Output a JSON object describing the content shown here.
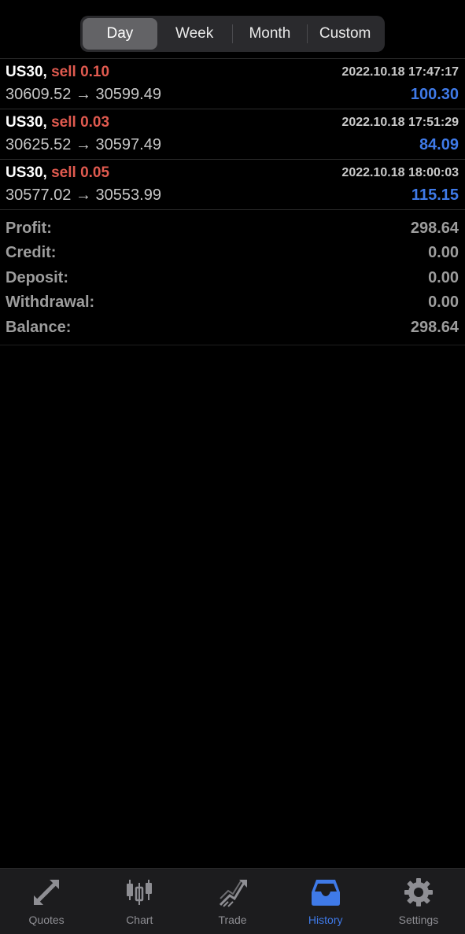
{
  "segments": {
    "day": "Day",
    "week": "Week",
    "month": "Month",
    "custom": "Custom",
    "selected": "Day"
  },
  "trades": [
    {
      "symbol": "US30,",
      "side_lot": "sell 0.10",
      "time": "2022.10.18 17:47:17",
      "open_price": "30609.52",
      "close_price": "30599.49",
      "arrow": "→",
      "profit": "100.30"
    },
    {
      "symbol": "US30,",
      "side_lot": "sell 0.03",
      "time": "2022.10.18 17:51:29",
      "open_price": "30625.52",
      "close_price": "30597.49",
      "arrow": "→",
      "profit": "84.09"
    },
    {
      "symbol": "US30,",
      "side_lot": "sell 0.05",
      "time": "2022.10.18 18:00:03",
      "open_price": "30577.02",
      "close_price": "30553.99",
      "arrow": "→",
      "profit": "115.15"
    }
  ],
  "summary": {
    "profit_label": "Profit:",
    "profit_value": "298.64",
    "credit_label": "Credit:",
    "credit_value": "0.00",
    "deposit_label": "Deposit:",
    "deposit_value": "0.00",
    "withdrawal_label": "Withdrawal:",
    "withdrawal_value": "0.00",
    "balance_label": "Balance:",
    "balance_value": "298.64"
  },
  "tabbar": {
    "quotes": {
      "label": "Quotes",
      "icon": "quotes-arrows-icon"
    },
    "chart": {
      "label": "Chart",
      "icon": "candlestick-icon"
    },
    "trade": {
      "label": "Trade",
      "icon": "trend-icon"
    },
    "history": {
      "label": "History",
      "icon": "inbox-tray-icon"
    },
    "settings": {
      "label": "Settings",
      "icon": "gear-icon"
    },
    "active": "History"
  },
  "colors": {
    "sell": "#e05a4f",
    "profit_positive": "#3f7ae8",
    "tab_active": "#3f7ae8",
    "tab_inactive": "#8e8e93"
  }
}
